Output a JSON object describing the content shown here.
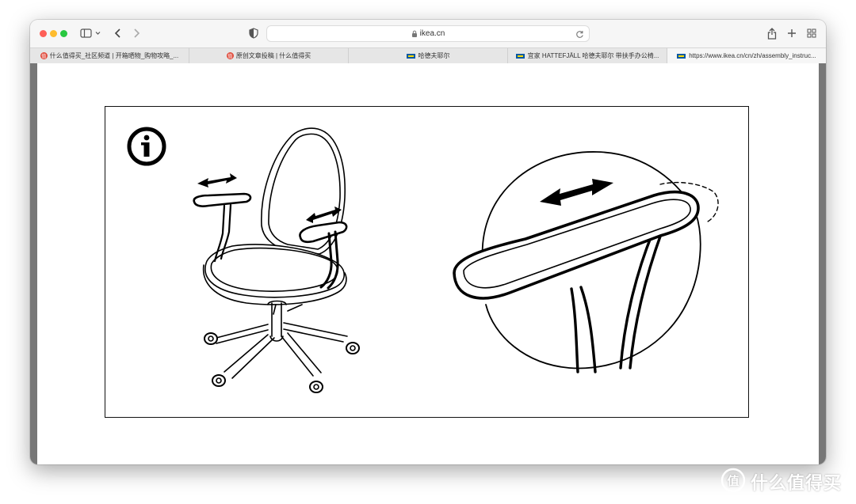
{
  "browser": {
    "address": "ikea.cn",
    "tabs": [
      {
        "label": "什么值得买_社区频道 | 开箱晒物_购物攻略_...",
        "favicon": "smzdm-icon"
      },
      {
        "label": "原创文章投稿 | 什么值得买",
        "favicon": "smzdm-icon"
      },
      {
        "label": "哈德夫耶尔",
        "favicon": "ikea-icon"
      },
      {
        "label": "宜家 HATTEFJÄLL 哈德夫耶尔 带扶手办公椅...",
        "favicon": "ikea-icon"
      },
      {
        "label": "https://www.ikea.cn/cn/zh/assembly_instruc...",
        "favicon": "ikea-icon"
      }
    ]
  },
  "favicon_glyph": "值",
  "watermark": {
    "text": "什么值得买",
    "glyph": "值"
  },
  "colors": {
    "traffic_red": "#fe5f57",
    "traffic_yellow": "#febc2e",
    "traffic_green": "#28c840",
    "ikea_blue": "#0058a3",
    "ikea_yellow": "#ffdb00",
    "smzdm_red": "#e04a3b"
  }
}
